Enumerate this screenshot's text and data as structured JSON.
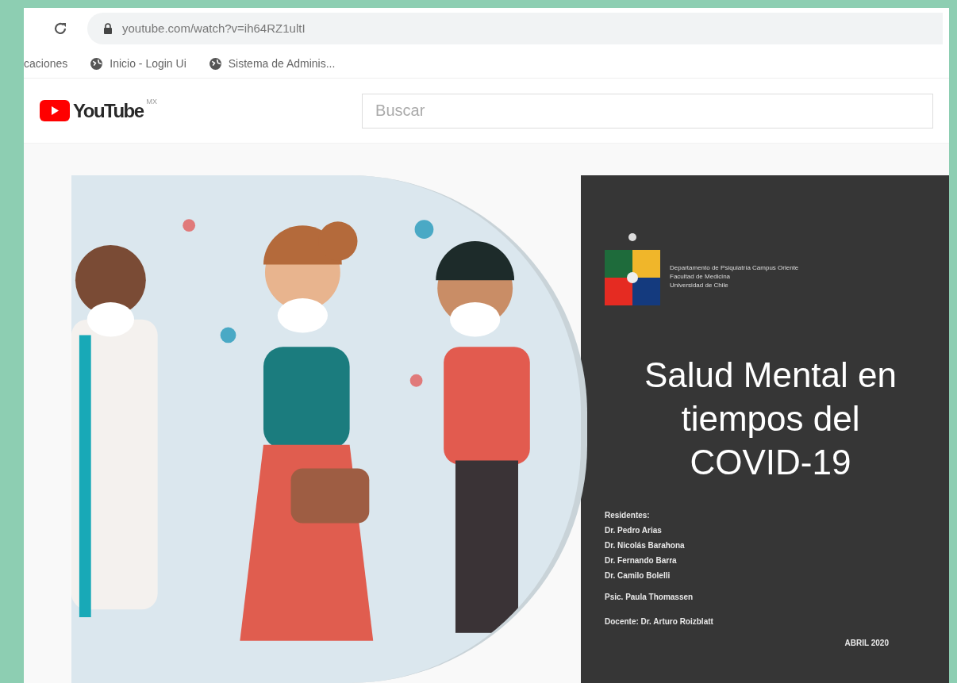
{
  "browser": {
    "url": "youtube.com/watch?v=ih64RZ1ultI",
    "bookmarks": [
      {
        "label": "caciones",
        "icon": false
      },
      {
        "label": "Inicio - Login Ui",
        "icon": true
      },
      {
        "label": "Sistema de Adminis...",
        "icon": true
      }
    ]
  },
  "youtube": {
    "logo": "YouTube",
    "region": "MX",
    "search": {
      "placeholder": "Buscar"
    }
  },
  "slide": {
    "institution": [
      "Departamento de Psiquiatría Campus Oriente",
      "Facultad de Medicina",
      "Universidad de Chile"
    ],
    "title": "Salud Mental en tiempos del COVID-19",
    "residents_heading": "Residentes:",
    "residents": [
      "Dr. Pedro Arias",
      "Dr. Nicolás Barahona",
      "Dr. Fernando Barra",
      "Dr. Camilo Bolelli"
    ],
    "psychologist": "Psic. Paula Thomassen",
    "teacher": "Docente: Dr. Arturo Roizblatt",
    "date": "ABRIL 2020"
  }
}
